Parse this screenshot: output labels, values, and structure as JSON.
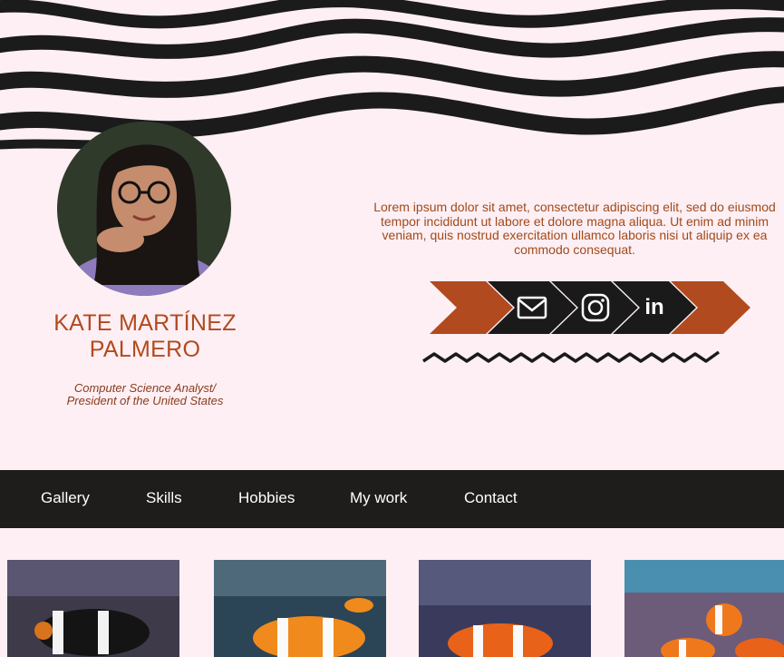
{
  "profile": {
    "name": "KATE MARTÍNEZ PALMERO",
    "name_line1": "KATE MARTÍNEZ",
    "name_line2": "PALMERO",
    "role_line1": "Computer Science Analyst/",
    "role_line2": "President of the United States"
  },
  "bio": {
    "text": "Lorem ipsum dolor sit amet, consectetur adipiscing elit, sed do eiusmod tempor incididunt ut labore et dolore magna aliqua. Ut enim ad minim veniam, quis nostrud exercitation ullamco laboris nisi ut aliquip ex ea commodo consequat."
  },
  "social": {
    "icons": [
      "mail-icon",
      "instagram-icon",
      "linkedin-icon"
    ],
    "linkedin_text": "in"
  },
  "nav": {
    "items": [
      "Gallery",
      "Skills",
      "Hobbies",
      "My work",
      "Contact"
    ]
  },
  "gallery": {
    "images": [
      "clownfish-photo-1",
      "clownfish-photo-2",
      "clownfish-photo-3",
      "clownfish-photo-4"
    ]
  },
  "colors": {
    "background": "#fdeff4",
    "accent": "#b14a1e",
    "nav_bg": "#1f1d1c",
    "dark": "#1a1a1a"
  }
}
